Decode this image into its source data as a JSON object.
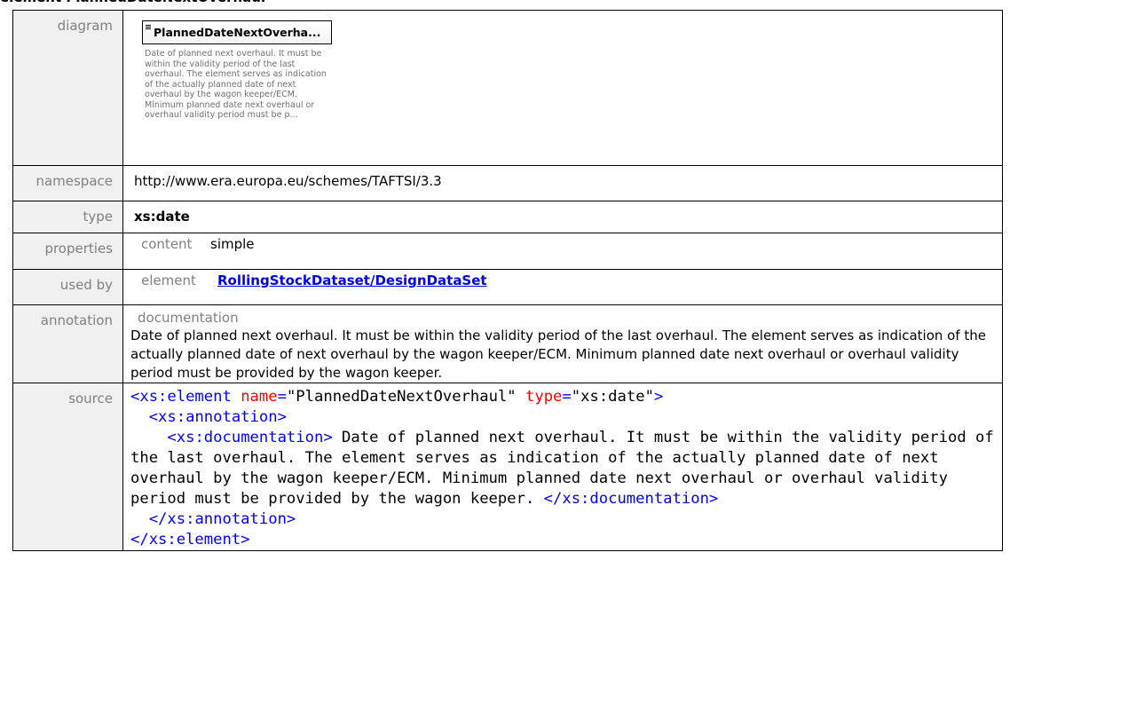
{
  "heading": "element PlannedDateNextOverhaul",
  "labels": {
    "diagram": "diagram",
    "namespace": "namespace",
    "type": "type",
    "properties": "properties",
    "used_by": "used by",
    "annotation": "annotation",
    "source": "source"
  },
  "diagram": {
    "box_title": "PlannedDateNextOverha...",
    "icon": "element-lines-icon",
    "description": "Date of planned next overhaul. It must be within the validity period of the last overhaul. The element serves as indication of the actually planned date of next overhaul by the wagon keeper/ECM. Minimum planned date next overhaul or overhaul validity period must be p..."
  },
  "namespace": "http://www.era.europa.eu/schemes/TAFTSI/3.3",
  "type": "xs:date",
  "properties": {
    "key": "content",
    "value": "simple"
  },
  "used_by": {
    "key": "element",
    "link": "RollingStockDataset/DesignDataSet"
  },
  "annotation": {
    "heading": "documentation",
    "text": " Date of planned next overhaul. It must be within the validity period of the last overhaul. The element serves as indication of the actually planned date of next overhaul by the wagon keeper/ECM. Minimum planned date next overhaul or overhaul validity period must be provided by the wagon keeper."
  },
  "source": {
    "l1_open": "<xs:element",
    "l1_attr1": "name",
    "l1_val1": "\"PlannedDateNextOverhaul\"",
    "l1_attr2": "type",
    "l1_val2": "\"xs:date\"",
    "l1_close": ">",
    "l2": "<xs:annotation>",
    "l3_open": "<xs:documentation>",
    "doc_text": " Date of planned next overhaul. It must be within the validity period of the last overhaul. The element serves as indication of the actually planned date of next overhaul by the wagon keeper/ECM. Minimum planned date next overhaul or overhaul validity period must be provided by the wagon keeper. ",
    "l3_close": "</xs:documentation>",
    "l4": "</xs:annotation>",
    "l5": "</xs:element>"
  }
}
